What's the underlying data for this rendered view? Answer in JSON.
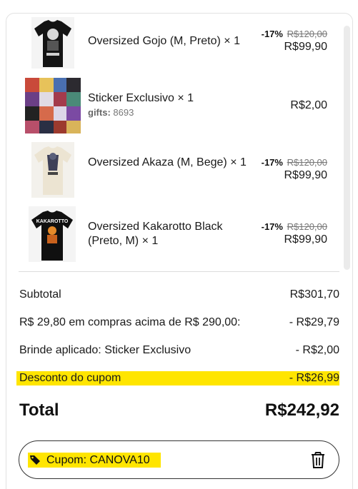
{
  "items": [
    {
      "title": "Oversized Gojo (M, Preto) × 1",
      "discount": "-17%",
      "old_price": "R$120,00",
      "price": "R$99,90",
      "thumb_icon": "black-tshirt-icon"
    },
    {
      "title": "Sticker Exclusivo × 1",
      "sub_label": "gifts:",
      "sub_value": "8693",
      "price": "R$2,00",
      "thumb_icon": "sticker-collage-icon"
    },
    {
      "title": "Oversized Akaza (M, Bege) × 1",
      "discount": "-17%",
      "old_price": "R$120,00",
      "price": "R$99,90",
      "thumb_icon": "beige-tshirt-icon"
    },
    {
      "title": "Oversized Kakarotto Black (Preto, M) × 1",
      "discount": "-17%",
      "old_price": "R$120,00",
      "price": "R$99,90",
      "thumb_icon": "black-tshirt-icon",
      "print_text": "KAKAROTTO"
    }
  ],
  "summary": {
    "subtotal_label": "Subtotal",
    "subtotal_value": "R$301,70",
    "promo_label": "R$ 29,80 em compras acima de R$ 290,00:",
    "promo_value": "- R$29,79",
    "gift_label": "Brinde aplicado: Sticker Exclusivo",
    "gift_value": "- R$2,00",
    "coupon_discount_label": "Desconto do cupom",
    "coupon_discount_value": "- R$26,99",
    "total_label": "Total",
    "total_value": "R$242,92"
  },
  "coupon": {
    "label": "Cupom: CANOVA10",
    "icon": "tag-icon",
    "remove_icon": "trash-icon"
  },
  "colors": {
    "highlight": "#ffe500",
    "border": "#e2e2e2",
    "text": "#1a1a1a"
  }
}
